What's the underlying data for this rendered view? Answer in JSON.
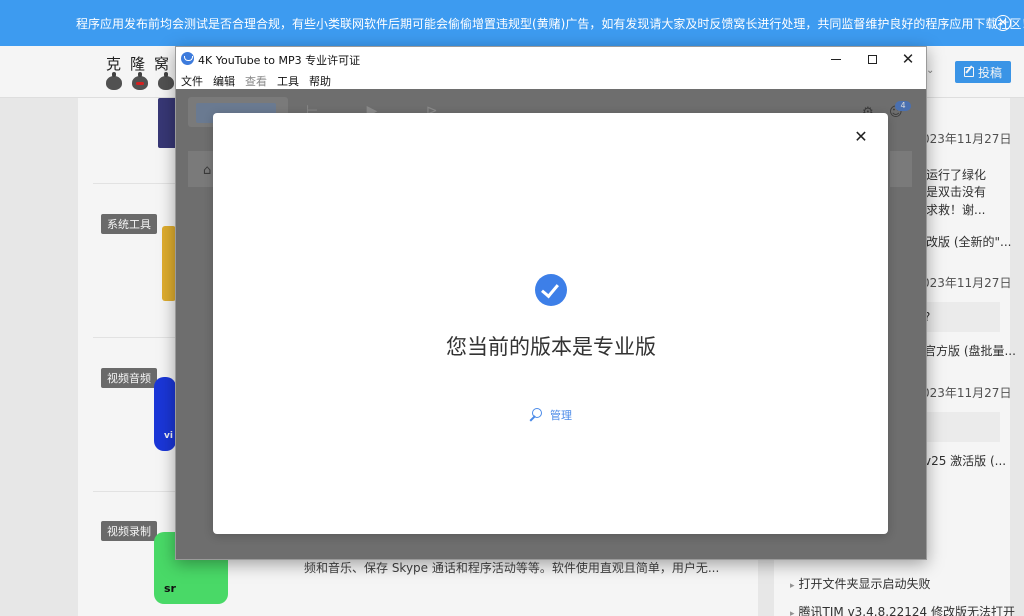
{
  "notice": {
    "text": "程序应用发布前均会测试是否合理合规，有些小类联网软件后期可能会偷偷增置违规型(黄赌)广告，如有发现请大家及时反馈窝长进行处理，共同监督维护良好的程序应用下载社区！",
    "close_glyph": "✕"
  },
  "site": {
    "logo_text": "克隆窝",
    "post_label": "投稿",
    "chevron": "⌄"
  },
  "posts": [
    {
      "badge": "",
      "snippet": ""
    },
    {
      "badge": "系统工具",
      "snippet": ""
    },
    {
      "badge": "视频音频",
      "snippet": ""
    },
    {
      "badge": "视频录制",
      "snippet": "频和音乐、保存 Skype 通话和程序活动等等。软件使用直观且简单，用户无..."
    }
  ],
  "thumb_labels": {
    "vd": "vi",
    "sr": "sr"
  },
  "sidebar": [
    {
      "text": "023年11月27日",
      "kind": "date"
    },
    {
      "text": "运行了绿化",
      "kind": "text"
    },
    {
      "text": "是双击没有",
      "kind": "text"
    },
    {
      "text": "求救！谢...",
      "kind": "text"
    },
    {
      "text": "改版 (全新的\"...",
      "kind": "text"
    },
    {
      "text": "023年11月27日",
      "kind": "date"
    },
    {
      "text": "?",
      "kind": "tint"
    },
    {
      "text": "官方版 (盘批量...",
      "kind": "text"
    },
    {
      "text": "023年11月27日",
      "kind": "date"
    },
    {
      "text": "",
      "kind": "tint"
    },
    {
      "text": "v25 激活版 (...",
      "kind": "text"
    },
    {
      "text": "打开文件夹显示启动失败",
      "kind": "bullet"
    },
    {
      "text": "腾讯TIM v3.4.8.22124 修改版无法打开",
      "kind": "bullet"
    }
  ],
  "window": {
    "title": "4K YouTube to MP3 专业许可证",
    "minimize_label": "",
    "close_glyph": "✕",
    "menu": [
      {
        "label": "文件",
        "enabled": true
      },
      {
        "label": "编辑",
        "enabled": true
      },
      {
        "label": "查看",
        "enabled": false
      },
      {
        "label": "工具",
        "enabled": true
      },
      {
        "label": "帮助",
        "enabled": true
      }
    ],
    "ghost": {
      "paste_tools": "⊢ ▶ ⊳",
      "home_glyph": "⌂",
      "settings_glyph": "⚙",
      "profile_glyph": "☺",
      "badge_count": "4"
    }
  },
  "modal": {
    "title": "您当前的版本是专业版",
    "manage_label": "管理",
    "close_glyph": "✕"
  },
  "colors": {
    "accent": "#3d9bf0",
    "check": "#3d7fe8",
    "link": "#4a8ae8",
    "backdrop": "#6e6e6e"
  }
}
